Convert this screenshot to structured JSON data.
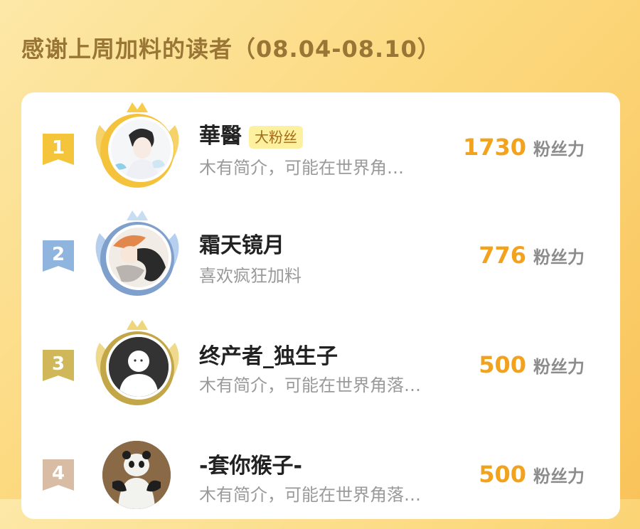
{
  "title": "感谢上周加料的读者（08.04-08.10）",
  "unit_label": "粉丝力",
  "readers": [
    {
      "rank": "1",
      "name": "華醫",
      "badge": "大粉丝",
      "bio": "木有简介，可能在世界角…",
      "score": "1730",
      "rank_color": "#f4c53a"
    },
    {
      "rank": "2",
      "name": "霜天镜月",
      "badge": "",
      "bio": "喜欢疯狂加料",
      "score": "776",
      "rank_color": "#8fb4de"
    },
    {
      "rank": "3",
      "name": "终产者_独生子",
      "badge": "",
      "bio": "木有简介，可能在世界角落…",
      "score": "500",
      "rank_color": "#cfb75a"
    },
    {
      "rank": "4",
      "name": "-套你猴子-",
      "badge": "",
      "bio": "木有简介，可能在世界角落…",
      "score": "500",
      "rank_color": "#d8bca4"
    }
  ]
}
